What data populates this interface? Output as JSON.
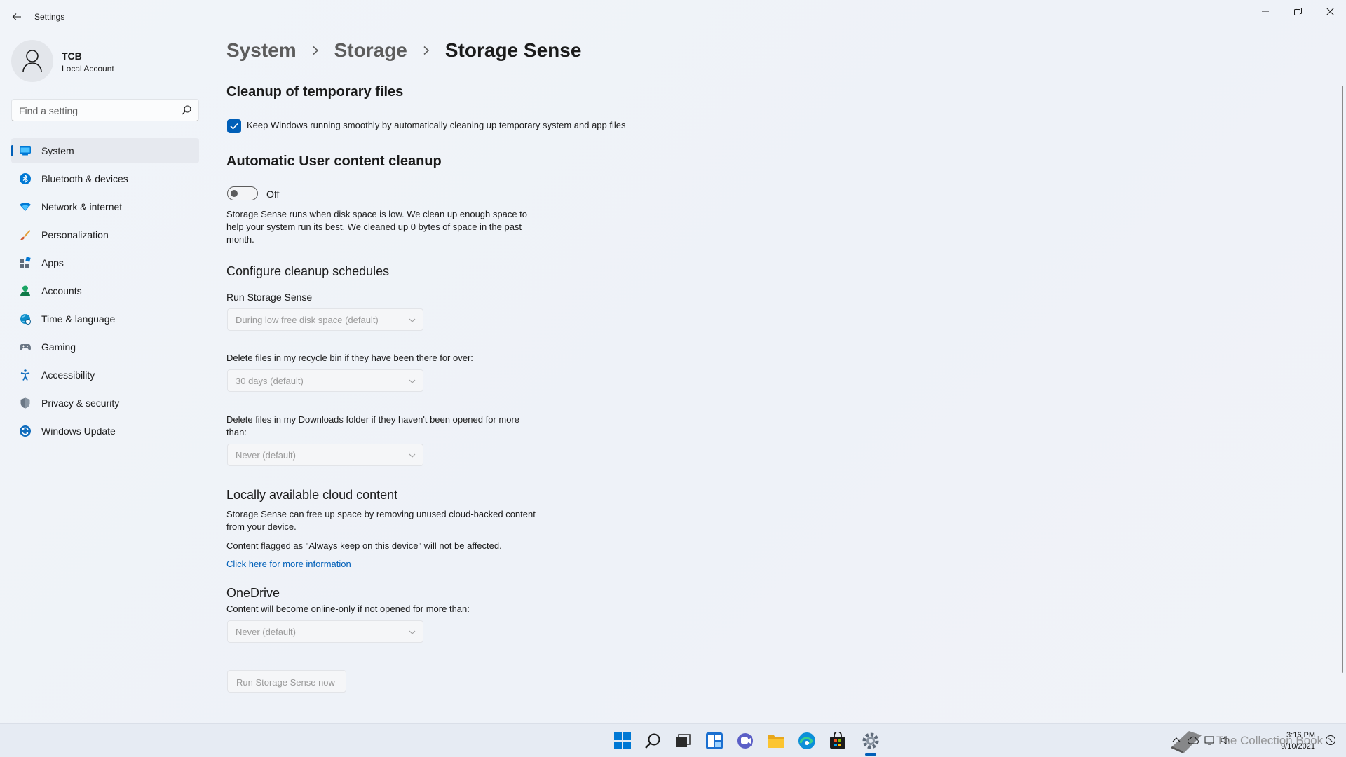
{
  "window": {
    "title": "Settings",
    "controls": {
      "minimize": "minimize-icon",
      "restore": "restore-icon",
      "close": "close-icon"
    }
  },
  "profile": {
    "name": "TCB",
    "account_type": "Local Account"
  },
  "search": {
    "placeholder": "Find a setting"
  },
  "sidebar": {
    "items": [
      {
        "label": "System",
        "icon": "monitor-icon",
        "active": true
      },
      {
        "label": "Bluetooth & devices",
        "icon": "bluetooth-icon"
      },
      {
        "label": "Network & internet",
        "icon": "wifi-icon"
      },
      {
        "label": "Personalization",
        "icon": "brush-icon"
      },
      {
        "label": "Apps",
        "icon": "apps-icon"
      },
      {
        "label": "Accounts",
        "icon": "person-icon"
      },
      {
        "label": "Time & language",
        "icon": "globe-clock-icon"
      },
      {
        "label": "Gaming",
        "icon": "gamepad-icon"
      },
      {
        "label": "Accessibility",
        "icon": "accessibility-icon"
      },
      {
        "label": "Privacy & security",
        "icon": "shield-icon"
      },
      {
        "label": "Windows Update",
        "icon": "update-icon"
      }
    ]
  },
  "breadcrumb": {
    "items": [
      "System",
      "Storage",
      "Storage Sense"
    ]
  },
  "content": {
    "temp_files": {
      "heading": "Cleanup of temporary files",
      "checkbox_label": "Keep Windows running smoothly by automatically cleaning up temporary system and app files",
      "checked": true
    },
    "auto_cleanup": {
      "heading": "Automatic User content cleanup",
      "toggle_state": "Off",
      "description": "Storage Sense runs when disk space is low. We clean up enough space to help your system run its best. We cleaned up 0 bytes of space in the past month."
    },
    "schedules": {
      "heading": "Configure cleanup schedules",
      "run_label": "Run Storage Sense",
      "run_value": "During low free disk space (default)",
      "recycle_label": "Delete files in my recycle bin if they have been there for over:",
      "recycle_value": "30 days (default)",
      "downloads_label": "Delete files in my Downloads folder if they haven't been opened for more than:",
      "downloads_value": "Never (default)"
    },
    "cloud": {
      "heading": "Locally available cloud content",
      "description": "Storage Sense can free up space by removing unused cloud-backed content from your device.",
      "note": "Content flagged as \"Always keep on this device\" will not be affected.",
      "link": "Click here for more information"
    },
    "onedrive": {
      "heading": "OneDrive",
      "label": "Content will become online-only if not opened for more than:",
      "value": "Never (default)"
    },
    "run_button": "Run Storage Sense now"
  },
  "taskbar": {
    "apps": [
      "start-icon",
      "search-icon",
      "task-view-icon",
      "widgets-icon",
      "chat-icon",
      "file-explorer-icon",
      "edge-icon",
      "store-icon",
      "settings-icon"
    ],
    "active_app": "settings-icon",
    "clock": {
      "time": "3:16 PM",
      "date": "9/10/2021"
    },
    "watermark": "The Collection Book"
  },
  "colors": {
    "accent": "#005fb8",
    "background": "#eef2f8",
    "taskbar": "#e6ebf3"
  }
}
